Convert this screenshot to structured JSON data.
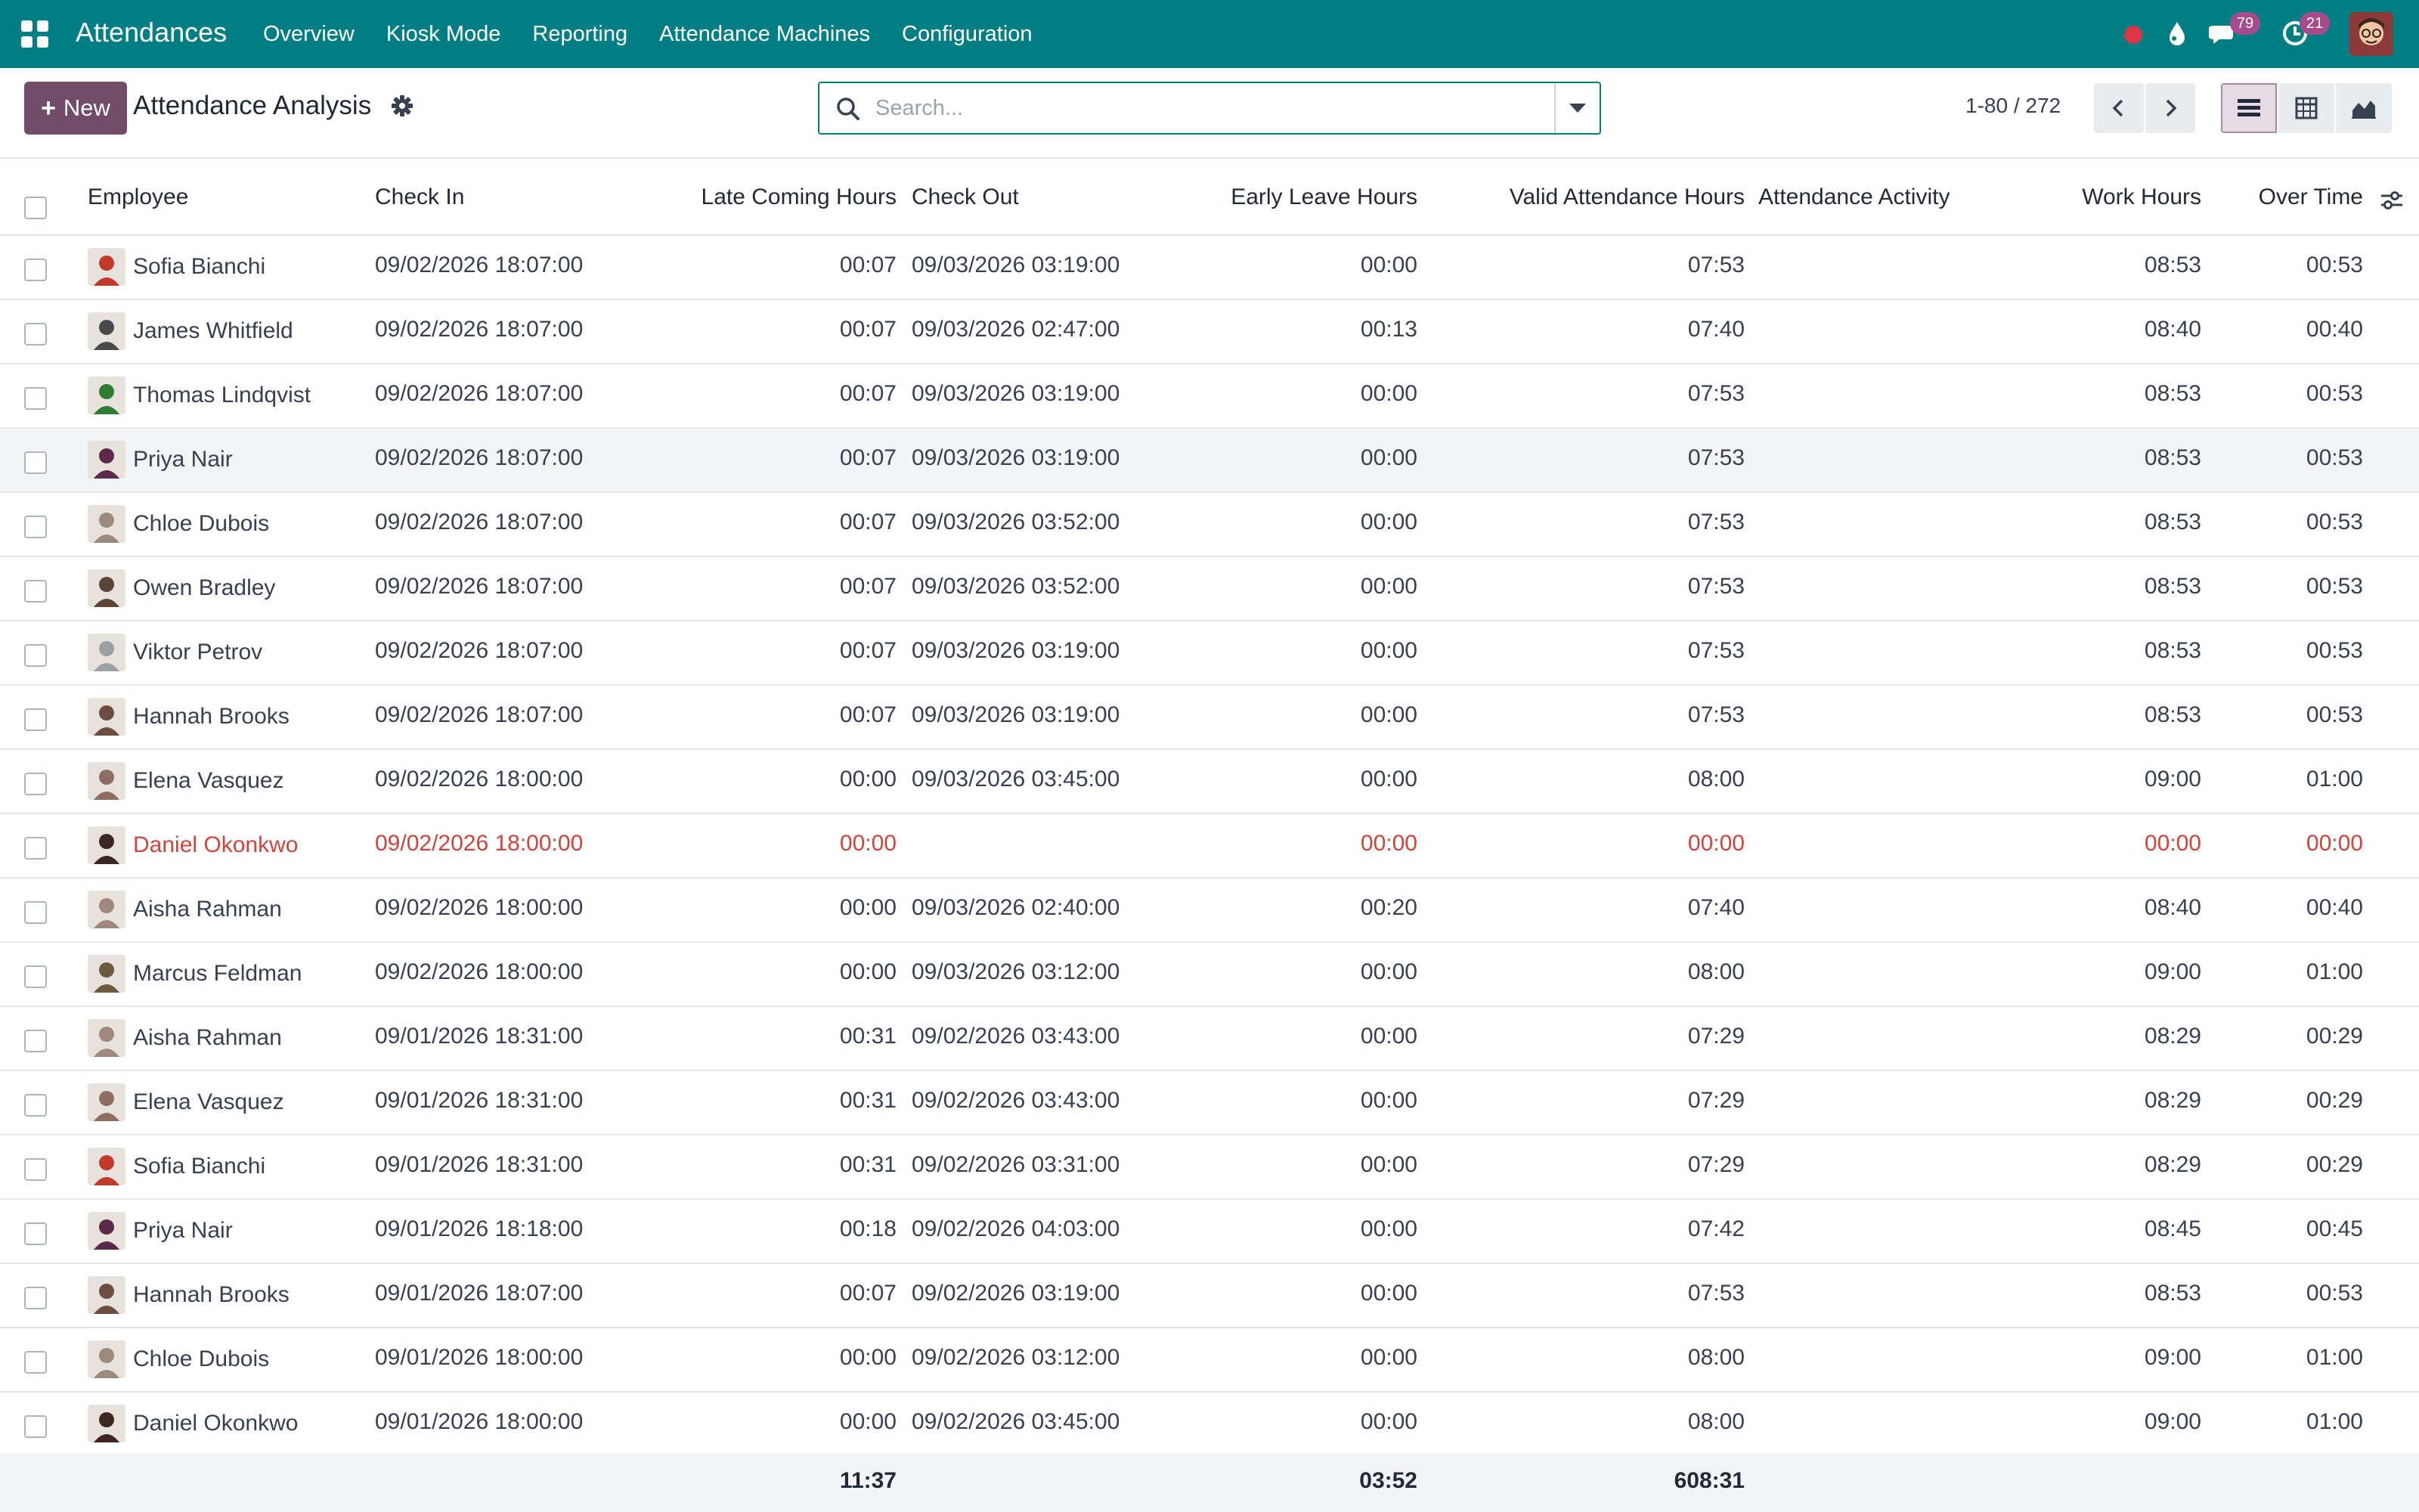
{
  "navbar": {
    "app_name": "Attendances",
    "menu": [
      "Overview",
      "Kiosk Mode",
      "Reporting",
      "Attendance Machines",
      "Configuration"
    ],
    "messages_count": "79",
    "activities_count": "21",
    "accent_color": "#017e84"
  },
  "control": {
    "new_label": "New",
    "title": "Attendance Analysis",
    "search_placeholder": "Search...",
    "pager": "1-80 / 272",
    "active_view": "list",
    "brand_color": "#714b67"
  },
  "table": {
    "headers": {
      "employee": "Employee",
      "check_in": "Check In",
      "late": "Late Coming Hours",
      "check_out": "Check Out",
      "early": "Early Leave Hours",
      "valid": "Valid Attendance Hours",
      "activity": "Attendance Activity",
      "work": "Work Hours",
      "overtime": "Over Time"
    },
    "rows": [
      {
        "employee": "Sofia Bianchi",
        "check_in": "09/02/2026 18:07:00",
        "late": "00:07",
        "check_out": "09/03/2026 03:19:00",
        "early": "00:00",
        "valid": "07:53",
        "activity": "",
        "work": "08:53",
        "overtime": "00:53",
        "avatar": "#c0392b"
      },
      {
        "employee": "James Whitfield",
        "check_in": "09/02/2026 18:07:00",
        "late": "00:07",
        "check_out": "09/03/2026 02:47:00",
        "early": "00:13",
        "valid": "07:40",
        "activity": "",
        "work": "08:40",
        "overtime": "00:40",
        "avatar": "#4a4a4a"
      },
      {
        "employee": "Thomas Lindqvist",
        "check_in": "09/02/2026 18:07:00",
        "late": "00:07",
        "check_out": "09/03/2026 03:19:00",
        "early": "00:00",
        "valid": "07:53",
        "activity": "",
        "work": "08:53",
        "overtime": "00:53",
        "avatar": "#2e7d32"
      },
      {
        "employee": "Priya Nair",
        "check_in": "09/02/2026 18:07:00",
        "late": "00:07",
        "check_out": "09/03/2026 03:19:00",
        "early": "00:00",
        "valid": "07:53",
        "activity": "",
        "work": "08:53",
        "overtime": "00:53",
        "avatar": "#5b2a4a"
      },
      {
        "employee": "Chloe Dubois",
        "check_in": "09/02/2026 18:07:00",
        "late": "00:07",
        "check_out": "09/03/2026 03:52:00",
        "early": "00:00",
        "valid": "07:53",
        "activity": "",
        "work": "08:53",
        "overtime": "00:53",
        "avatar": "#9e8a7a"
      },
      {
        "employee": "Owen Bradley",
        "check_in": "09/02/2026 18:07:00",
        "late": "00:07",
        "check_out": "09/03/2026 03:52:00",
        "early": "00:00",
        "valid": "07:53",
        "activity": "",
        "work": "08:53",
        "overtime": "00:53",
        "avatar": "#5a4636"
      },
      {
        "employee": "Viktor Petrov",
        "check_in": "09/02/2026 18:07:00",
        "late": "00:07",
        "check_out": "09/03/2026 03:19:00",
        "early": "00:00",
        "valid": "07:53",
        "activity": "",
        "work": "08:53",
        "overtime": "00:53",
        "avatar": "#9aa0a6"
      },
      {
        "employee": "Hannah Brooks",
        "check_in": "09/02/2026 18:07:00",
        "late": "00:07",
        "check_out": "09/03/2026 03:19:00",
        "early": "00:00",
        "valid": "07:53",
        "activity": "",
        "work": "08:53",
        "overtime": "00:53",
        "avatar": "#6d4c41"
      },
      {
        "employee": "Elena Vasquez",
        "check_in": "09/02/2026 18:00:00",
        "late": "00:00",
        "check_out": "09/03/2026 03:45:00",
        "early": "00:00",
        "valid": "08:00",
        "activity": "",
        "work": "09:00",
        "overtime": "01:00",
        "avatar": "#8d6e63"
      },
      {
        "employee": "Daniel Okonkwo",
        "check_in": "09/02/2026 18:00:00",
        "late": "00:00",
        "check_out": "",
        "early": "00:00",
        "valid": "00:00",
        "activity": "",
        "work": "00:00",
        "overtime": "00:00",
        "avatar": "#3e2723",
        "danger": true
      },
      {
        "employee": "Aisha Rahman",
        "check_in": "09/02/2026 18:00:00",
        "late": "00:00",
        "check_out": "09/03/2026 02:40:00",
        "early": "00:20",
        "valid": "07:40",
        "activity": "",
        "work": "08:40",
        "overtime": "00:40",
        "avatar": "#a1887f"
      },
      {
        "employee": "Marcus Feldman",
        "check_in": "09/02/2026 18:00:00",
        "late": "00:00",
        "check_out": "09/03/2026 03:12:00",
        "early": "00:00",
        "valid": "08:00",
        "activity": "",
        "work": "09:00",
        "overtime": "01:00",
        "avatar": "#6b5a3e"
      },
      {
        "employee": "Aisha Rahman",
        "check_in": "09/01/2026 18:31:00",
        "late": "00:31",
        "check_out": "09/02/2026 03:43:00",
        "early": "00:00",
        "valid": "07:29",
        "activity": "",
        "work": "08:29",
        "overtime": "00:29",
        "avatar": "#a1887f"
      },
      {
        "employee": "Elena Vasquez",
        "check_in": "09/01/2026 18:31:00",
        "late": "00:31",
        "check_out": "09/02/2026 03:43:00",
        "early": "00:00",
        "valid": "07:29",
        "activity": "",
        "work": "08:29",
        "overtime": "00:29",
        "avatar": "#8d6e63"
      },
      {
        "employee": "Sofia Bianchi",
        "check_in": "09/01/2026 18:31:00",
        "late": "00:31",
        "check_out": "09/02/2026 03:31:00",
        "early": "00:00",
        "valid": "07:29",
        "activity": "",
        "work": "08:29",
        "overtime": "00:29",
        "avatar": "#c0392b"
      },
      {
        "employee": "Priya Nair",
        "check_in": "09/01/2026 18:18:00",
        "late": "00:18",
        "check_out": "09/02/2026 04:03:00",
        "early": "00:00",
        "valid": "07:42",
        "activity": "",
        "work": "08:45",
        "overtime": "00:45",
        "avatar": "#5b2a4a"
      },
      {
        "employee": "Hannah Brooks",
        "check_in": "09/01/2026 18:07:00",
        "late": "00:07",
        "check_out": "09/02/2026 03:19:00",
        "early": "00:00",
        "valid": "07:53",
        "activity": "",
        "work": "08:53",
        "overtime": "00:53",
        "avatar": "#6d4c41"
      },
      {
        "employee": "Chloe Dubois",
        "check_in": "09/01/2026 18:00:00",
        "late": "00:00",
        "check_out": "09/02/2026 03:12:00",
        "early": "00:00",
        "valid": "08:00",
        "activity": "",
        "work": "09:00",
        "overtime": "01:00",
        "avatar": "#9e8a7a"
      },
      {
        "employee": "Daniel Okonkwo",
        "check_in": "09/01/2026 18:00:00",
        "late": "00:00",
        "check_out": "09/02/2026 03:45:00",
        "early": "00:00",
        "valid": "08:00",
        "activity": "",
        "work": "09:00",
        "overtime": "01:00",
        "avatar": "#3e2723"
      }
    ],
    "totals": {
      "late": "11:37",
      "early": "03:52",
      "valid": "608:31"
    }
  }
}
